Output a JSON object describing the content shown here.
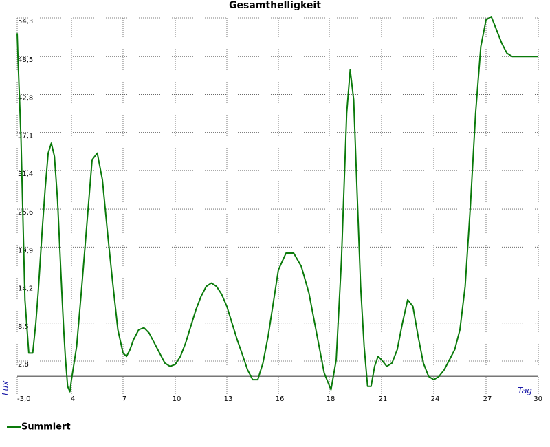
{
  "colors": {
    "series": "#0a7a0a",
    "baseline": "#777777",
    "grid": "#555555",
    "axis_label": "#1a1aa8"
  },
  "chart_data": {
    "type": "line",
    "title": "Gesamthelligkeit",
    "xlabel": "Tag",
    "ylabel": "Lux",
    "xlim": [
      -3,
      30
    ],
    "ylim": [
      -3,
      55
    ],
    "grid": true,
    "legend_position": "bottom-left",
    "x_ticks": [
      -3,
      4,
      7,
      10,
      13,
      16,
      18,
      21,
      24,
      27,
      30
    ],
    "x_tick_labels": [
      "-3,0",
      "4",
      "7",
      "10",
      "13",
      "16",
      "18",
      "21",
      "24",
      "27",
      "30"
    ],
    "y_ticks": [
      2.8,
      8.5,
      14.2,
      19.9,
      25.6,
      31.4,
      37.1,
      42.8,
      48.5,
      54.3
    ],
    "y_tick_labels": [
      "2,8",
      "8,5",
      "14,2",
      "19,9",
      "25,6",
      "31,4",
      "37,1",
      "42,8",
      "48,5",
      "54,3"
    ],
    "baseline": 0.5,
    "series": [
      {
        "name": "Summiert",
        "x": [
          -3.0,
          -2.9,
          -2.5,
          -2.0,
          -1.5,
          -1.0,
          -0.6,
          -0.3,
          0.2,
          0.6,
          1.0,
          1.4,
          1.8,
          2.2,
          2.6,
          2.8,
          3.0,
          3.2,
          3.5,
          3.8,
          4.0,
          4.3,
          4.6,
          4.9,
          5.2,
          5.5,
          5.8,
          6.1,
          6.4,
          6.7,
          7.0,
          7.2,
          7.4,
          7.6,
          7.9,
          8.2,
          8.5,
          8.8,
          9.1,
          9.4,
          9.7,
          10.0,
          10.3,
          10.6,
          10.9,
          11.2,
          11.5,
          11.8,
          12.1,
          12.4,
          12.7,
          13.0,
          13.3,
          13.6,
          13.9,
          14.2,
          14.5,
          14.8,
          15.1,
          15.4,
          15.7,
          16.0,
          16.3,
          16.6,
          16.9,
          17.2,
          17.5,
          17.8,
          18.1,
          18.4,
          18.7,
          19.0,
          19.2,
          19.4,
          19.6,
          19.8,
          20.0,
          20.2,
          20.4,
          20.6,
          20.8,
          21.0,
          21.3,
          21.6,
          21.9,
          22.2,
          22.5,
          22.8,
          23.1,
          23.4,
          23.7,
          24.0,
          24.3,
          24.6,
          24.9,
          25.2,
          25.5,
          25.8,
          26.1,
          26.4,
          26.7,
          27.0,
          27.3,
          27.6,
          27.9,
          28.2,
          28.5,
          28.8,
          29.1,
          29.4,
          29.7,
          30.0
        ],
        "y": [
          52.0,
          48.5,
          36.0,
          12.0,
          4.0,
          4.0,
          8.5,
          13.0,
          22.0,
          28.5,
          34.0,
          35.5,
          33.5,
          27.0,
          17.0,
          12.0,
          7.5,
          3.5,
          -1.0,
          -1.8,
          0.0,
          5.0,
          14.0,
          23.5,
          33.0,
          34.0,
          30.0,
          22.0,
          14.5,
          7.5,
          4.0,
          3.5,
          4.5,
          6.0,
          7.5,
          7.8,
          7.0,
          5.5,
          4.0,
          2.5,
          2.0,
          2.3,
          3.5,
          5.5,
          8.0,
          10.5,
          12.5,
          14.0,
          14.5,
          14.0,
          12.8,
          11.0,
          8.5,
          6.0,
          3.8,
          1.5,
          0.0,
          0.0,
          2.5,
          6.5,
          11.5,
          16.5,
          19.0,
          19.0,
          17.0,
          13.0,
          7.0,
          1.0,
          -1.5,
          3.0,
          18.0,
          40.0,
          46.5,
          42.0,
          28.0,
          14.0,
          5.0,
          -1.0,
          -1.0,
          2.0,
          3.5,
          3.0,
          2.0,
          2.5,
          4.5,
          8.5,
          12.0,
          11.0,
          6.5,
          2.5,
          0.5,
          0.0,
          0.5,
          1.5,
          3.0,
          4.5,
          7.5,
          14.0,
          26.0,
          40.0,
          50.0,
          54.0,
          54.5,
          52.5,
          50.5,
          49.0,
          48.5,
          48.5,
          48.5,
          48.5,
          48.5,
          48.5
        ]
      }
    ]
  }
}
